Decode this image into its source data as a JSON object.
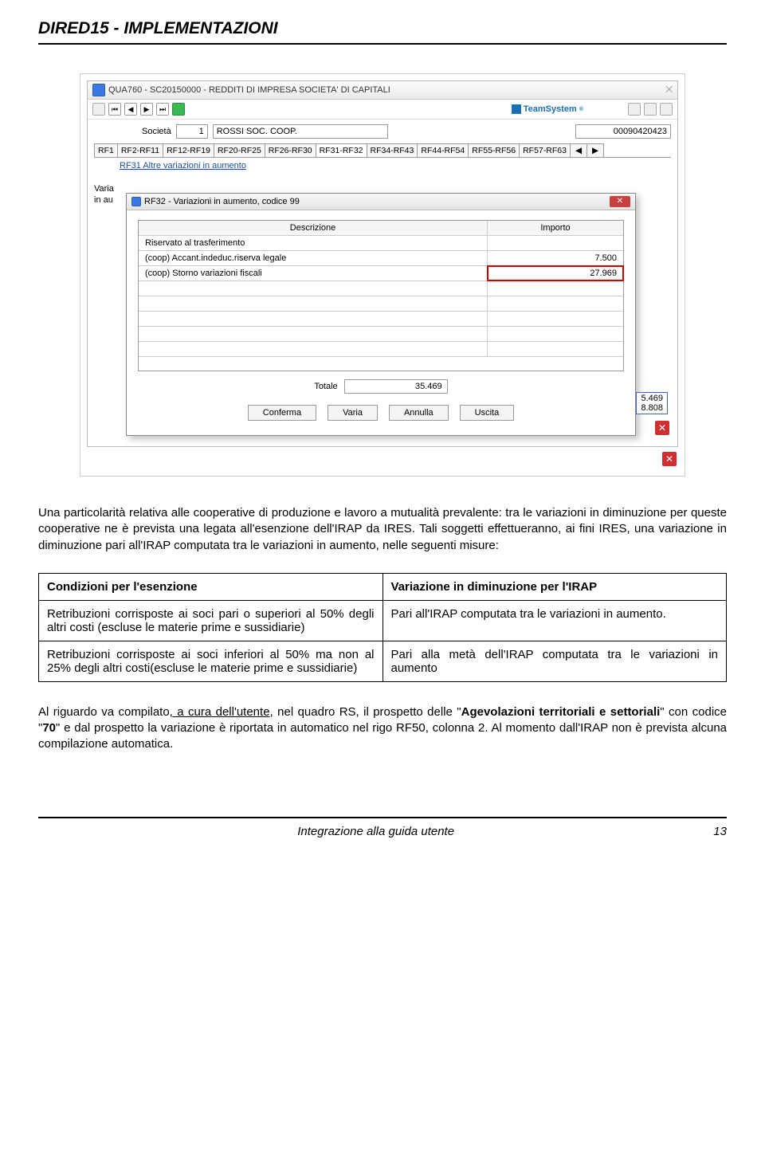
{
  "doc": {
    "title": "DIRED15 - IMPLEMENTAZIONI",
    "footer_left": "",
    "footer_center": "Integrazione alla guida utente",
    "footer_right": "13"
  },
  "shot": {
    "main_title": "QUA760 - SC20150000 - REDDITI DI IMPRESA SOCIETA' DI CAPITALI",
    "teamsystem": "TeamSystem",
    "societa_label": "Società",
    "societa_num": "1",
    "societa_name": "ROSSI SOC. COOP.",
    "societa_fisc": "00090420423",
    "tabs": [
      "RF1",
      "RF2-RF11",
      "RF12-RF19",
      "RF20-RF25",
      "RF26-RF30",
      "RF31-RF32",
      "RF34-RF43",
      "RF44-RF54",
      "RF55-RF56",
      "RF57-RF63"
    ],
    "sub_label": "RF31    Altre variazioni in aumento",
    "left1": "Varia",
    "left2": "in au",
    "dialog_title": "RF32 - Variazioni in aumento, codice 99",
    "col1": "Descrizione",
    "col2": "Importo",
    "rows": [
      {
        "d": "Riservato al trasferimento",
        "v": ""
      },
      {
        "d": "(coop) Accant.indeduc.riserva legale",
        "v": "7.500"
      },
      {
        "d": "(coop) Storno variazioni fiscali",
        "v": "27.969"
      }
    ],
    "tot_label": "Totale",
    "tot_val": "35.469",
    "btns": [
      "Conferma",
      "Varia",
      "Annulla",
      "Uscita"
    ],
    "corner": [
      "5.469",
      "8.808"
    ]
  },
  "body": {
    "p1": "Una particolarità relativa alle cooperative di produzione e lavoro a mutualità prevalente: tra le variazioni in diminuzione per queste cooperative ne è prevista una legata all'esenzione dell'IRAP da IRES. Tali soggetti effettueranno, ai fini IRES, una variazione in diminuzione pari all'IRAP computata tra le variazioni in aumento, nelle seguenti misure:",
    "th1": "Condizioni per l'esenzione",
    "th2": "Variazione in diminuzione per l'IRAP",
    "r1c1": "Retribuzioni corrisposte ai soci pari o superiori al 50% degli altri costi (escluse le materie prime e sussidiarie)",
    "r1c2": "Pari all'IRAP computata tra le variazioni in aumento.",
    "r2c1": "Retribuzioni corrisposte ai soci inferiori al 50% ma non al 25% degli altri costi(escluse le materie prime e sussidiarie)",
    "r2c2": "Pari alla metà dell'IRAP computata tra le variazioni in aumento",
    "p2a": "Al riguardo va compilato",
    "p2u": ", a cura dell'utente,",
    "p2b": " nel quadro RS, il prospetto delle \"",
    "p2bold": "Agevolazioni territoriali e settoriali",
    "p2c": "\" con codice \"",
    "p2bold2": "70",
    "p2d": "\" e dal prospetto la variazione è riportata in automatico nel rigo RF50, colonna 2. Al momento dall'IRAP non è prevista alcuna compilazione automatica."
  }
}
